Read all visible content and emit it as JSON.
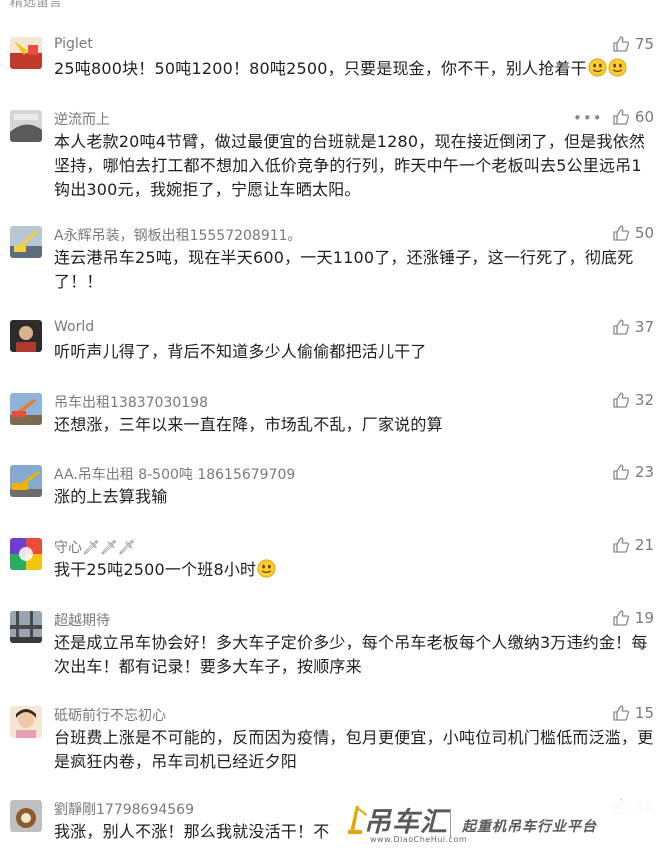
{
  "header": {
    "title": "精选留言"
  },
  "comments": [
    {
      "name": "Piglet",
      "text": "25吨800块！50吨1200！80吨2500，只要是现金，你不干，别人抢着干",
      "emoji_count": 2,
      "likes": "75",
      "more": "",
      "avatar_colors": [
        "#c0392b",
        "#f1c40f"
      ]
    },
    {
      "name": "逆流而上",
      "text": "本人老款20吨4节臂，做过最便宜的台班就是1280，现在接近倒闭了，但是我依然坚持，哪怕去打工都不想加入低价竞争的行列，昨天中午一个老板叫去5公里远吊1钩出300元，我婉拒了，宁愿让车晒太阳。",
      "emoji_count": 0,
      "likes": "60",
      "more": "•••",
      "avatar_colors": [
        "#6b6b6b",
        "#cfcfcf"
      ]
    },
    {
      "name": "A永辉吊装，钢板出租15557208911。",
      "text": "连云港吊车25吨，现在半天600，一天1100了，还涨锤子，这一行死了，彻底死了！！",
      "emoji_count": 0,
      "likes": "50",
      "more": "",
      "avatar_colors": [
        "#5d6d7e",
        "#f4d03f"
      ]
    },
    {
      "name": "World",
      "text": "听听声儿得了，背后不知道多少人偷偷都把活儿干了",
      "emoji_count": 0,
      "likes": "37",
      "more": "",
      "avatar_colors": [
        "#2c2c2c",
        "#b03a2e"
      ]
    },
    {
      "name": "吊车出租13837030198",
      "text": "还想涨，三年以来一直在降，市场乱不乱，厂家说的算",
      "emoji_count": 0,
      "likes": "32",
      "more": "",
      "avatar_colors": [
        "#8fb3d9",
        "#e67e22"
      ]
    },
    {
      "name": "AA.吊车出租 8-500吨 18615679709",
      "text": "涨的上去算我输",
      "emoji_count": 0,
      "likes": "23",
      "more": "",
      "avatar_colors": [
        "#85a9cf",
        "#f0b400"
      ]
    },
    {
      "name": "守心🗡🗡🗡",
      "text": "我干25吨2500一个班8小时",
      "emoji_count": 1,
      "likes": "21",
      "more": "",
      "avatar_colors": [
        "#6c3fd1",
        "#27ae60"
      ]
    },
    {
      "name": "超越期待",
      "text": "还是成立吊车协会好！多大车子定价多少，每个吊车老板每个人缴纳3万违约金！每次出车！都有记录！要多大车子，按顺序来",
      "emoji_count": 0,
      "likes": "19",
      "more": "",
      "avatar_colors": [
        "#4a4a4a",
        "#9aa5b1"
      ]
    },
    {
      "name": "砥砺前行不忘初心",
      "text": "台班费上涨是不可能的，反而因为疫情，包月更便宜，小吨位司机门槛低而泛滥，更是疯狂内卷，吊车司机已经近夕阳",
      "emoji_count": 0,
      "likes": "15",
      "more": "",
      "avatar_colors": [
        "#e8a0b4",
        "#f5e6d3"
      ]
    },
    {
      "name": "劉靜剛17798694569",
      "text": "我涨，别人不涨！那么我就没活干！不",
      "emoji_count": 0,
      "likes": "14",
      "more": "",
      "avatar_colors": [
        "#c0c0c0",
        "#8b5a2b"
      ]
    }
  ],
  "watermark": {
    "brand": "吊车汇",
    "url": "www.DiaoCheHui.com",
    "slogan": "起重机吊车行业平台"
  },
  "colors": {
    "meta_gray": "#7a7a7a",
    "text_dark": "#1f1f1f",
    "emoji_yellow": "#ffcc33"
  },
  "icons": {
    "like": "thumbs-up-icon",
    "more": "more-dots-icon",
    "emoji": "smiley-emoji-icon"
  }
}
